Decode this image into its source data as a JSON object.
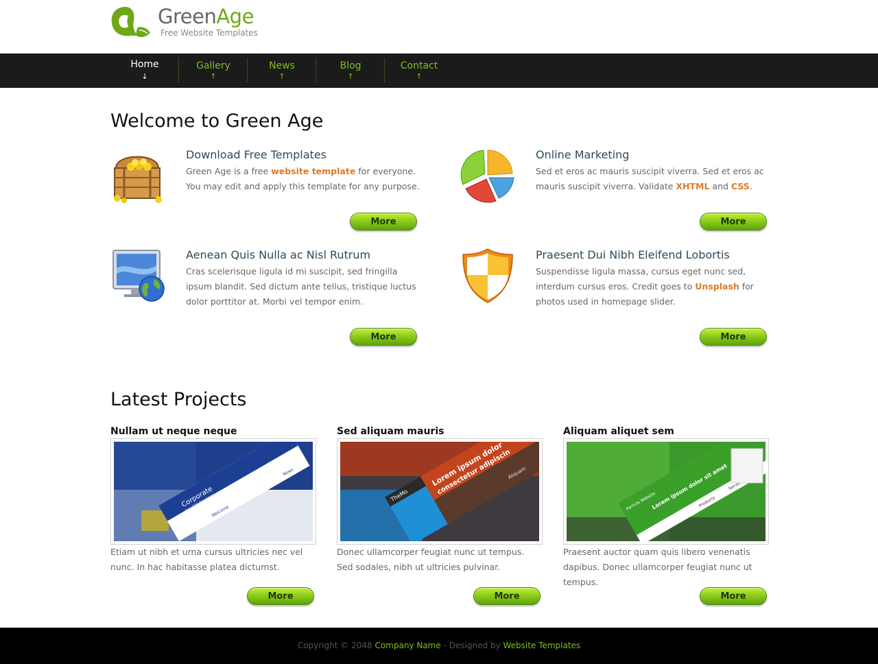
{
  "brand": {
    "name_part1": "Green",
    "name_part2": "Age",
    "tagline": "Free Website Templates"
  },
  "nav": {
    "items": [
      {
        "label": "Home",
        "arrow": "↓"
      },
      {
        "label": "Gallery",
        "arrow": "↑"
      },
      {
        "label": "News",
        "arrow": "↑"
      },
      {
        "label": "Blog",
        "arrow": "↑"
      },
      {
        "label": "Contact",
        "arrow": "↑"
      }
    ],
    "active": "Home"
  },
  "welcome": {
    "title": "Welcome to Green Age",
    "features": [
      {
        "title": "Download Free Templates",
        "text_1": "Green Age is a free ",
        "link_1": "website template",
        "text_2": " for everyone. You may edit and apply this template for any purpose.",
        "icon": "treasure-chest-icon",
        "button": "More"
      },
      {
        "title": "Online Marketing",
        "text_1": "Sed et eros ac mauris suscipit viverra. Sed et eros ac mauris suscipit viverra. Validate ",
        "link_1": "XHTML",
        "text_2": " and ",
        "link_2": "CSS",
        "text_3": ".",
        "icon": "pie-chart-icon",
        "button": "More"
      },
      {
        "title": "Aenean Quis Nulla ac Nisl Rutrum",
        "text_1": "Cras scelerisque ligula id mi suscipit, sed fringilla ipsum blandit. Sed dictum ante tellus, tristique luctus dolor porttitor at. Morbi vel tempor enim.",
        "icon": "monitor-globe-icon",
        "button": "More"
      },
      {
        "title": "Praesent Dui Nibh Eleifend Lobortis",
        "text_1": "Suspendisse ligula massa, cursus eget nunc sed, interdum cursus eros. Credit goes to ",
        "link_1": "Unsplash",
        "text_2": " for photos used in homepage slider.",
        "icon": "shield-icon",
        "button": "More"
      }
    ]
  },
  "projects": {
    "title": "Latest Projects",
    "items": [
      {
        "title": "Nullam ut neque neque",
        "text": "Etiam ut nibh et urna cursus ultricies nec vel nunc. In hac habitasse platea dictumst.",
        "button": "More",
        "thumb_labels": [
          "Corporate",
          "Free CSS Templates",
          "Welcome",
          "News"
        ]
      },
      {
        "title": "Sed aliquam mauris",
        "text": "Donec ullamcorper feugiat nunc ut tempus. Sed sodales, nibh ut ultricies pulvinar.",
        "button": "More",
        "thumb_labels": [
          "TheMo",
          "Lorem ipsum dolor",
          "consectetur adipiscin",
          "Aliquam"
        ]
      },
      {
        "title": "Aliquam aliquet sem",
        "text": "Praesent auctor quam quis libero venenatis dapibus. Donec ullamcorper feugiat nunc ut tempus.",
        "button": "More",
        "thumb_labels": [
          "Particle Website",
          "Lorem ipsum dolor sit amet",
          "Products",
          "Services"
        ]
      }
    ]
  },
  "footer": {
    "copyright": "Copyright © 2048 ",
    "company": "Company Name",
    "designed_by": " - Designed by ",
    "designer": "Website Templates"
  },
  "colors": {
    "accent_green": "#7bc01d",
    "link_orange": "#e07a23",
    "nav_bg": "#1b1b1b",
    "footer_bg": "#000000"
  }
}
